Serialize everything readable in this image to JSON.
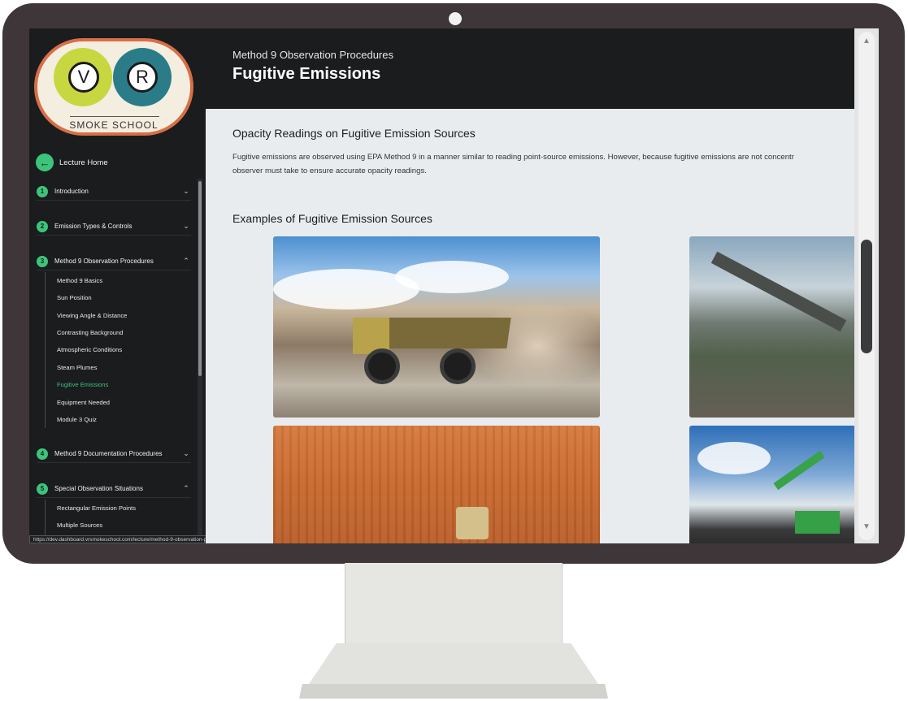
{
  "brand": {
    "logo_left_letter": "V",
    "logo_right_letter": "R",
    "logo_caption": "SMOKE SCHOOL"
  },
  "sidebar": {
    "home_label": "Lecture Home",
    "home_icon": "arrow-left-icon",
    "modules": [
      {
        "num": "1",
        "label": "Introduction",
        "chevron": "⌄"
      },
      {
        "num": "2",
        "label": "Emission Types & Controls",
        "chevron": "⌄"
      },
      {
        "num": "3",
        "label": "Method 9 Observation Procedures",
        "chevron": "⌃",
        "subitems": [
          "Method 9 Basics",
          "Sun Position",
          "Viewing Angle & Distance",
          "Contrasting Background",
          "Atmospheric Conditions",
          "Steam Plumes",
          "Fugitive Emissions",
          "Equipment Needed",
          "Module 3 Quiz"
        ],
        "active_index": 6
      },
      {
        "num": "4",
        "label": "Method 9 Documentation Procedures",
        "chevron": "⌄"
      },
      {
        "num": "5",
        "label": "Special Observation Situations",
        "chevron": "⌃",
        "subitems": [
          "Rectangular Emission Points",
          "Multiple Sources"
        ]
      }
    ]
  },
  "status_url": "https://dev.dashboard.vrsmokeschool.com/lecture/method-9-observation-procedures/equipment-needed",
  "header": {
    "kicker": "Method 9 Observation Procedures",
    "title": "Fugitive Emissions"
  },
  "content": {
    "section1_title": "Opacity Readings on Fugitive Emission Sources",
    "section1_line1": "Fugitive emissions are observed using EPA Method 9 in a manner similar to reading point-source emissions. However, because fugitive emissions are not concentr",
    "section1_line2": "observer must take to ensure accurate opacity readings.",
    "section2_title": "Examples of Fugitive Emission Sources"
  },
  "colors": {
    "accent_green": "#3cc57a",
    "sidebar_bg": "#1b1c1e",
    "header_bg": "#1b1c1e",
    "content_bg": "#e9ecef"
  }
}
